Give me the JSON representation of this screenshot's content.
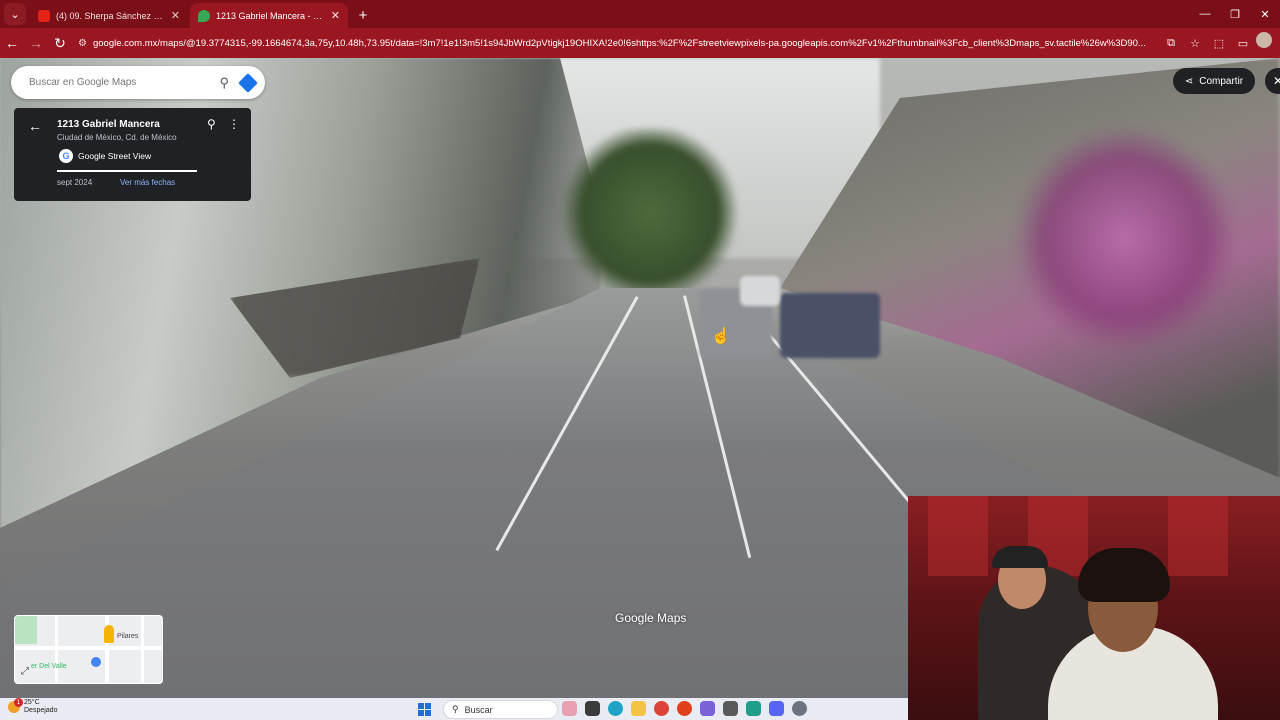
{
  "browser": {
    "tabs": [
      {
        "title": "(4) 09. Sherpa Sánchez - Party S",
        "favicon_color": "#e62117",
        "active": false
      },
      {
        "title": "1213 Gabriel Mancera - Google",
        "favicon_color": "#34a853",
        "active": true
      }
    ],
    "new_tab": "+",
    "url": "google.com.mx/maps/@19.3774315,-99.1664674,3a,75y,10.48h,73.95t/data=!3m7!1e1!3m5!1s94JbWrd2pVtigkj19OHIXA!2e0!6shttps:%2F%2Fstreetviewpixels-pa.googleapis.com%2Fv1%2Fthumbnail%3Fcb_client%3Dmaps_sv.tactile%26w%3D90..."
  },
  "maps": {
    "search_placeholder": "Buscar en Google Maps",
    "place": {
      "name": "1213 Gabriel Mancera",
      "city": "Ciudad de México, Cd. de México",
      "source": "Google Street View",
      "date": "sept 2024",
      "more_dates": "Ver más fechas"
    },
    "share_label": "Compartir",
    "watermark": "Google Maps",
    "minimap": {
      "label_pilares": "Pilares",
      "label_valle": "er Del Valle"
    }
  },
  "taskbar": {
    "temperature": "25°C",
    "condition": "Despejado",
    "notification_count": "1",
    "search_label": "Buscar"
  },
  "colors": {
    "chrome_tabbar": "#7a0f17",
    "chrome_active": "#9a1621",
    "maps_link": "#8ab4f8"
  }
}
